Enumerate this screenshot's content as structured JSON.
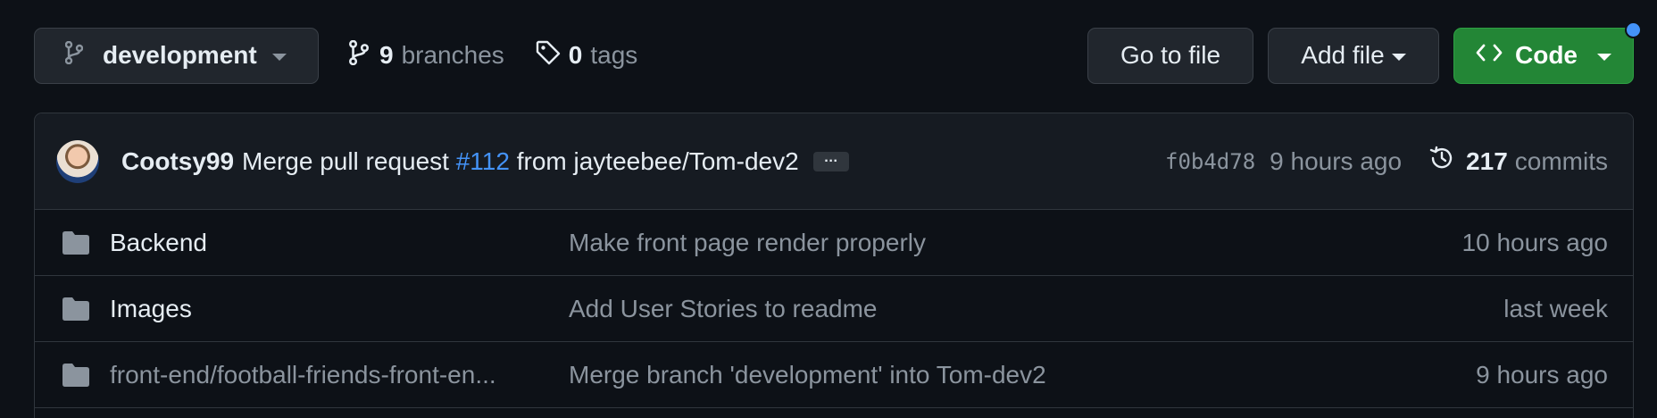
{
  "toolbar": {
    "branch_name": "development",
    "branches_count": "9",
    "branches_label": "branches",
    "tags_count": "0",
    "tags_label": "tags",
    "goto_file_label": "Go to file",
    "add_file_label": "Add file",
    "code_label": "Code"
  },
  "commit": {
    "author": "Cootsy99",
    "message_prefix": "Merge pull request",
    "pr_number": "#112",
    "message_suffix": "from jayteebee/Tom-dev2",
    "ellipsis": "…",
    "sha": "f0b4d78",
    "time": "9 hours ago",
    "commits_count": "217",
    "commits_label": "commits"
  },
  "files": [
    {
      "name": "Backend",
      "commit_message": "Make front page render properly",
      "time": "10 hours ago"
    },
    {
      "name": "Images",
      "commit_message": "Add User Stories to readme",
      "time": "last week"
    },
    {
      "name": "front-end/football-friends-front-en...",
      "commit_message": "Merge branch 'development' into Tom-dev2",
      "time": "9 hours ago"
    }
  ],
  "icons": {
    "branch": "git-branch-icon",
    "tag": "tag-icon",
    "code": "code-icon",
    "history": "history-icon",
    "folder": "folder-icon"
  },
  "colors": {
    "background": "#0d1117",
    "header_bg": "#161b22",
    "border": "#30363d",
    "code_button": "#238636",
    "link_blue": "#4493f8",
    "muted_text": "#8b949e"
  }
}
